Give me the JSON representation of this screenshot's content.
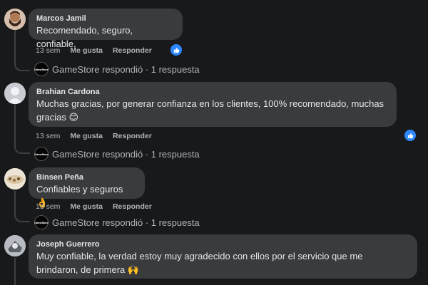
{
  "comments": [
    {
      "author": "Marcos Jamil",
      "text": "Recomendado, seguro, confiable,",
      "time": "13 sem",
      "like_label": "Me gusta",
      "reply_label": "Responder",
      "reply_summary": "GameStore respondió · 1 respuesta"
    },
    {
      "author": "Brahian Cardona",
      "text_line1": "Muchas gracias, por generar confianza en los clientes, 100% recomendado, muchas",
      "text_line2": "gracias 😊",
      "time": "13 sem",
      "like_label": "Me gusta",
      "reply_label": "Responder",
      "reply_summary": "GameStore respondió · 1 respuesta"
    },
    {
      "author": "Binsen Peña",
      "text": "Confiables y seguros 👌",
      "time": "13 sem",
      "like_label": "Me gusta",
      "reply_label": "Responder",
      "reply_summary": "GameStore respondió · 1 respuesta"
    },
    {
      "author": "Joseph Guerrero",
      "text_line1": "Muy confiable, la verdad estoy muy agradecido con ellos por el servicio que me",
      "text_line2": "brindaron, de primera 🙌"
    }
  ],
  "reply_logo_text": "GameStore",
  "colors": {
    "background": "#18191a",
    "bubble": "#3a3b3c",
    "like_blue": "#2d88ff",
    "secondary_text": "#b0b3b8"
  }
}
